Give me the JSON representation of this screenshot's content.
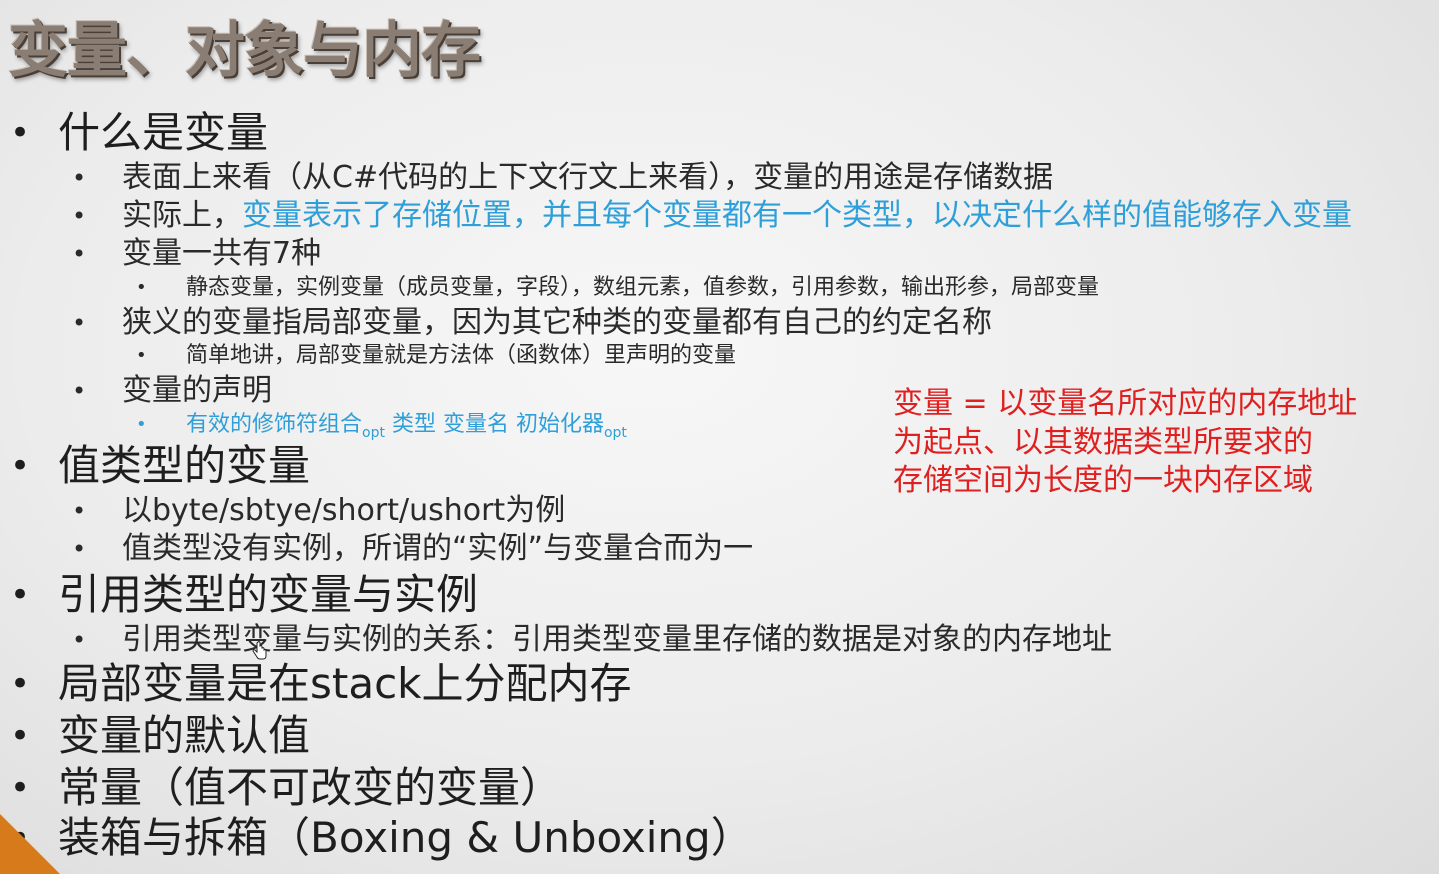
{
  "title": "变量、对象与内存",
  "bullets": {
    "b1": "什么是变量",
    "b1_1": "表面上来看（从C#代码的上下文行文上来看），变量的用途是存储数据",
    "b1_2_black": "实际上，",
    "b1_2_blue": "变量表示了存储位置，并且每个变量都有一个类型，以决定什么样的值能够存入变量",
    "b1_3": "变量一共有7种",
    "b1_3_1": "静态变量，实例变量（成员变量，字段），数组元素，值参数，引用参数，输出形参，局部变量",
    "b1_4": "狭义的变量指局部变量，因为其它种类的变量都有自己的约定名称",
    "b1_4_1": "简单地讲，局部变量就是方法体（函数体）里声明的变量",
    "b1_5": "变量的声明",
    "b1_5_1_a": "有效的修饰符组合",
    "b1_5_1_sub1": "opt",
    "b1_5_1_b": " 类型 变量名 初始化器",
    "b1_5_1_sub2": "opt",
    "b2": "值类型的变量",
    "b2_1": "以byte/sbtye/short/ushort为例",
    "b2_2": "值类型没有实例，所谓的“实例”与变量合而为一",
    "b3": "引用类型的变量与实例",
    "b3_1": "引用类型变量与实例的关系：引用类型变量里存储的数据是对象的内存地址",
    "b4": "局部变量是在stack上分配内存",
    "b5": "变量的默认值",
    "b6": "常量（值不可改变的变量）",
    "b7": "装箱与拆箱（Boxing & Unboxing）"
  },
  "callout": {
    "line1": "变量 = 以变量名所对应的内存地址",
    "line2": "为起点、以其数据类型所要求的",
    "line3": "存储空间为长度的一块内存区域"
  },
  "colors": {
    "highlight_blue": "#2e9fd8",
    "callout_red": "#e02020",
    "corner_orange": "#d77a1c"
  },
  "icons": {
    "bullet": "•",
    "cursor": "hand-cursor-icon"
  }
}
